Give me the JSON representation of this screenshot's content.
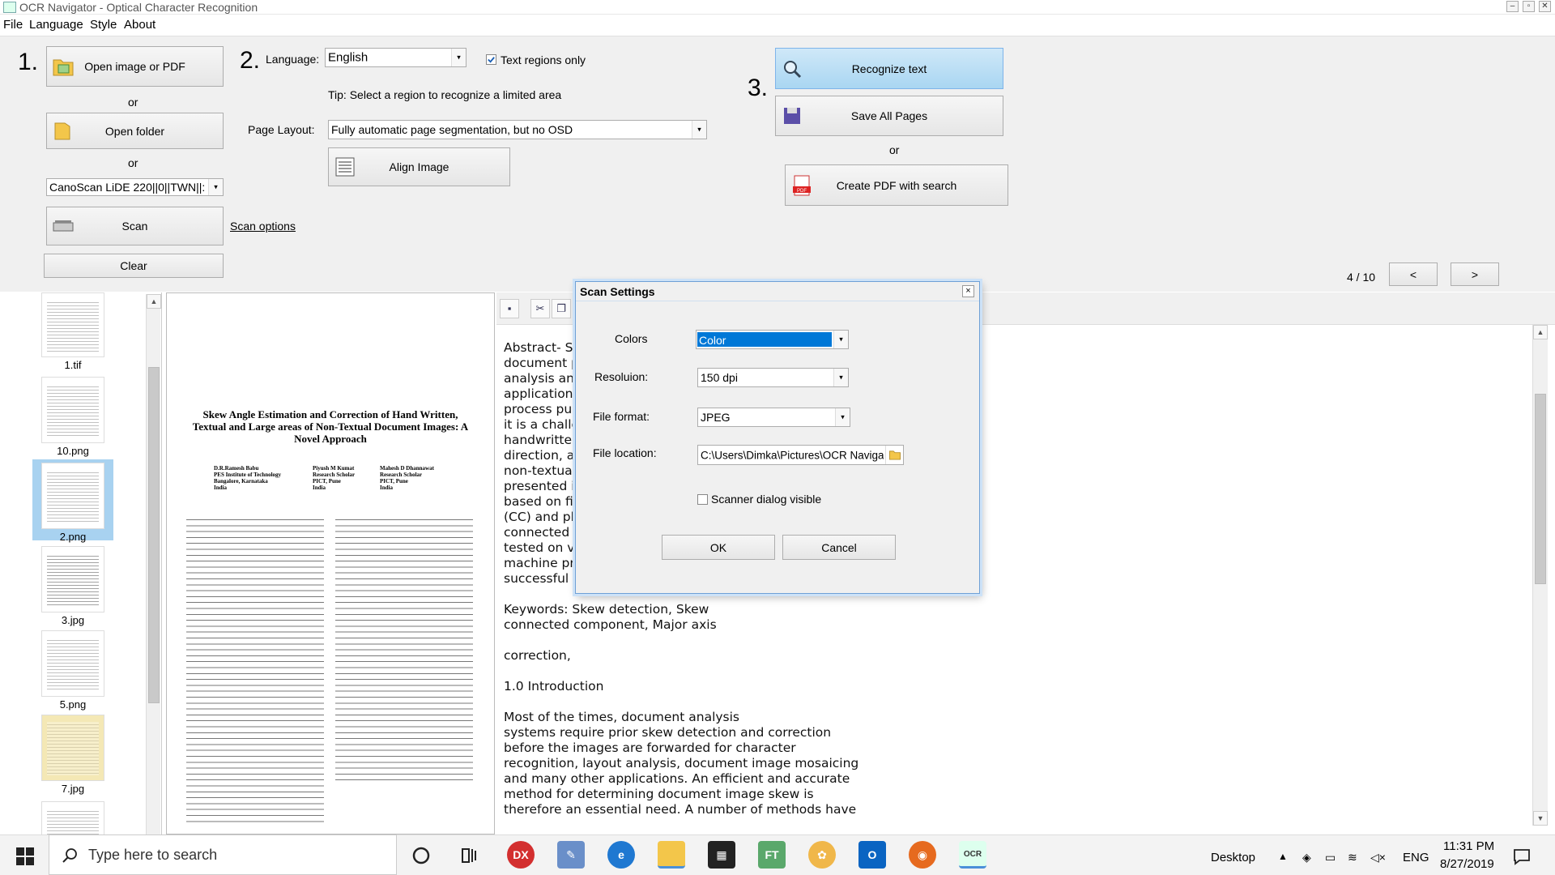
{
  "window": {
    "title": "OCR Navigator - Optical Character Recognition"
  },
  "menu": [
    "File",
    "Language",
    "Style",
    "About"
  ],
  "steps": {
    "one": "1.",
    "two": "2.",
    "three": "3."
  },
  "left_controls": {
    "open_image": "Open image or PDF",
    "or1": "or",
    "open_folder": "Open folder",
    "or2": "or",
    "scanner": "CanoScan LiDE 220||0||TWN||:",
    "scan": "Scan",
    "scan_options": "Scan options",
    "clear": "Clear"
  },
  "middle_controls": {
    "language_label": "Language:",
    "language_value": "English",
    "text_regions_only": "Text regions only",
    "tip": "Tip: Select a region to recognize a limited area",
    "page_layout_label": "Page Layout:",
    "page_layout_value": "Fully automatic page segmentation, but no OSD",
    "align_image": "Align Image"
  },
  "right_controls": {
    "recognize": "Recognize text",
    "save_all": "Save All Pages",
    "or": "or",
    "create_pdf": "Create PDF with search",
    "page_indicator": "4 / 10",
    "prev": "<",
    "next": ">"
  },
  "thumbnails": [
    {
      "name": "1.tif"
    },
    {
      "name": "10.png"
    },
    {
      "name": "2.png",
      "selected": true
    },
    {
      "name": "3.jpg"
    },
    {
      "name": "5.png"
    },
    {
      "name": "7.jpg"
    }
  ],
  "document": {
    "title": "Skew Angle Estimation and Correction of Hand Written, Textual and Large areas of Non-Textual Document Images:  A Novel Approach",
    "authors": [
      "D.R.Ramesh Babu\nPES Institute of Technology\nBangalore, Karnataka\nIndia",
      "Piyush M Kumat\nResearch Scholar\nPICT, Pune\nIndia",
      "Mahesh D Dhannawat\nResearch Scholar\nPICT, Pune\nIndia"
    ]
  },
  "ocr_text": "Abstract- Sk\ndocument pa\nanalysis and\napplications.\nprocess pure\nit is a challer\nhandwritten,\ndirection, a r\nnon-textual,\npresented in\nbased on fin\n(CC) and plo\nconnected co\ntested on va\nmachine prin\nsuccessful ra\n\nKeywords: Skew detection, Skew\nconnected component, Major axis\n\ncorrection,\n\n1.0 Introduction\n\nMost of the times, document analysis\nsystems require prior skew detection and correction\nbefore the images are forwarded for character\nrecognition, layout analysis, document image mosaicing\nand many other applications. An efficient and accurate\nmethod for determining document image skew is\ntherefore an essential need. A number of methods have",
  "dialog": {
    "title": "Scan Settings",
    "close": "×",
    "colors_label": "Colors",
    "colors_value": "Color",
    "resolution_label": "Resoluion:",
    "resolution_value": "150 dpi",
    "format_label": "File format:",
    "format_value": "JPEG",
    "location_label": "File location:",
    "location_value": "C:\\Users\\Dimka\\Pictures\\OCR Navigator",
    "scanner_dialog": "Scanner dialog visible",
    "ok": "OK",
    "cancel": "Cancel"
  },
  "taskbar": {
    "search_placeholder": "Type here to search",
    "desktop": "Desktop",
    "lang": "ENG",
    "time": "11:31 PM",
    "date": "8/27/2019"
  }
}
